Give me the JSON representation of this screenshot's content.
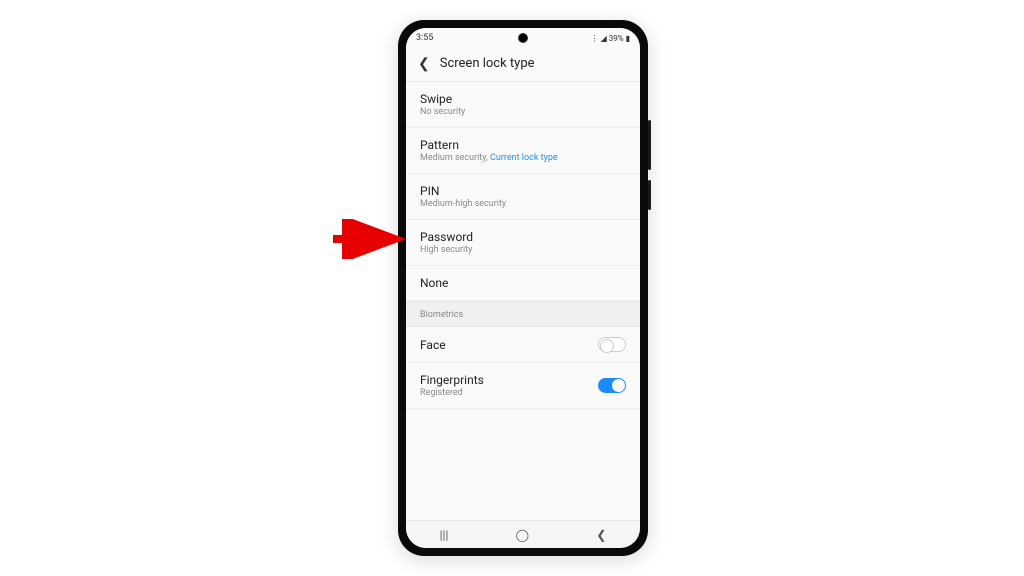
{
  "statusbar": {
    "time": "3:55",
    "battery": "39%"
  },
  "header": {
    "title": "Screen lock type"
  },
  "lock_options": [
    {
      "title": "Swipe",
      "sub": "No security",
      "highlight": ""
    },
    {
      "title": "Pattern",
      "sub": "Medium security, ",
      "highlight": "Current lock type"
    },
    {
      "title": "PIN",
      "sub": "Medium-high security",
      "highlight": ""
    },
    {
      "title": "Password",
      "sub": "High security",
      "highlight": ""
    },
    {
      "title": "None",
      "sub": "",
      "highlight": ""
    }
  ],
  "biometrics_header": "Biometrics",
  "biometrics": [
    {
      "title": "Face",
      "sub": "",
      "on": false
    },
    {
      "title": "Fingerprints",
      "sub": "Registered",
      "on": true
    }
  ],
  "annotation": {
    "arrow_color": "#e60000"
  }
}
